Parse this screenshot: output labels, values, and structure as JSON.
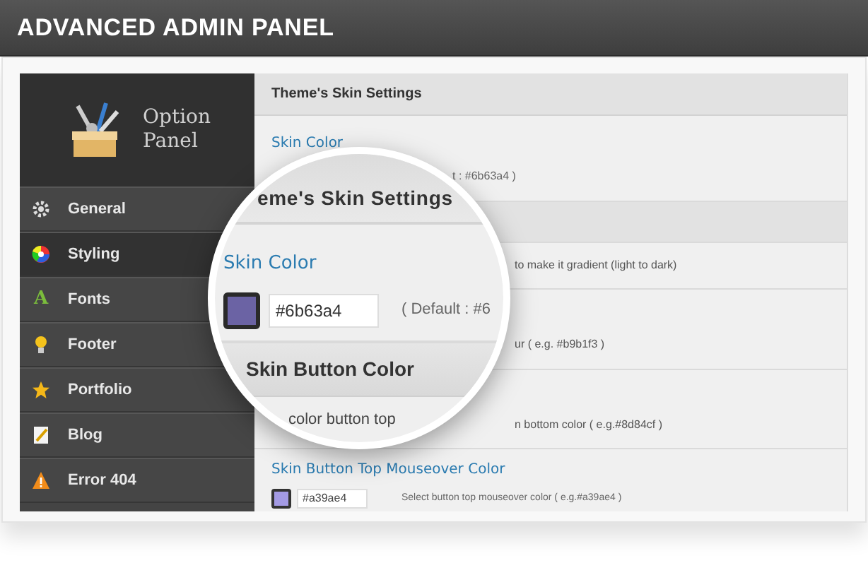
{
  "header": {
    "title": "ADVANCED ADMIN PANEL"
  },
  "sidebar": {
    "logo_lines": [
      "Option",
      "Panel"
    ],
    "items": [
      {
        "label": "General",
        "kind": "gear",
        "selected": false
      },
      {
        "label": "Styling",
        "kind": "wheel",
        "selected": true
      },
      {
        "label": "Fonts",
        "kind": "letter",
        "icon_text": "A",
        "selected": false
      },
      {
        "label": "Footer",
        "kind": "bulb",
        "selected": false
      },
      {
        "label": "Portfolio",
        "kind": "star",
        "selected": false
      },
      {
        "label": "Blog",
        "kind": "note",
        "selected": false
      },
      {
        "label": "Error 404",
        "kind": "warning",
        "selected": false
      }
    ]
  },
  "content": {
    "section_title": "Theme's Skin Settings",
    "rows": [
      {
        "kind": "color",
        "label": "Skin Color",
        "note": "t : #6b63a4 )"
      },
      {
        "kind": "band"
      },
      {
        "kind": "note",
        "note": "to make it gradient (light to dark)"
      },
      {
        "kind": "note",
        "note": "ur ( e.g. #b9b1f3 )"
      },
      {
        "kind": "note",
        "note": "n bottom color ( e.g.#8d84cf )"
      },
      {
        "kind": "field",
        "label": "Skin Button Top Mouseover Color",
        "color": "#a39ae4",
        "value": "#a39ae4",
        "note": "Select button top mouseover color ( e.g.#a39ae4 )"
      }
    ]
  },
  "magnifier": {
    "section_title": "eme's Skin Settings",
    "label": "Skin Color",
    "color": "#6b63a4",
    "value": "#6b63a4",
    "note": "( Default : #6",
    "band_title": "Skin Button Color",
    "partial_text": "color button top"
  }
}
